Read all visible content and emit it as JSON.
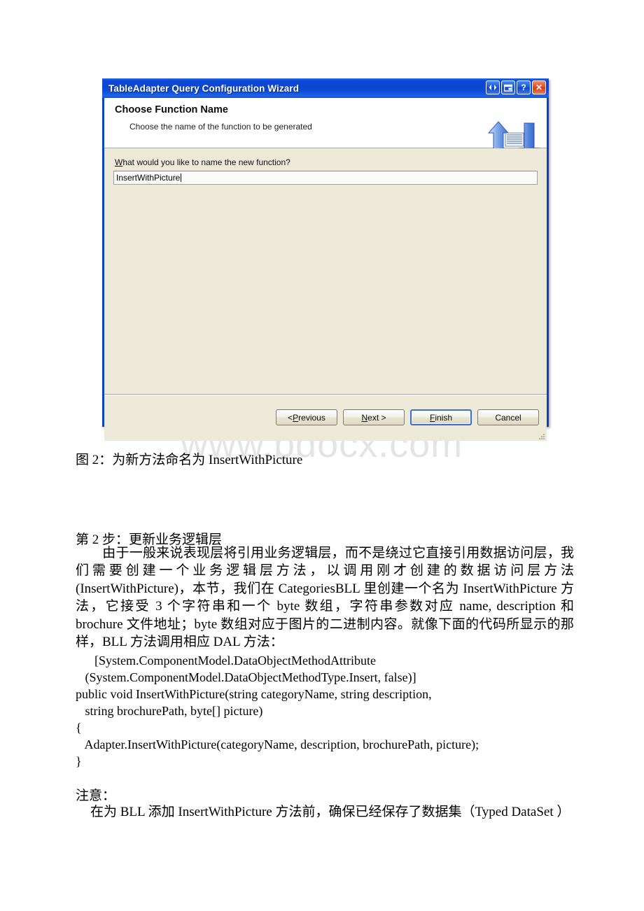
{
  "watermark": "www.bdocx.com",
  "dialog": {
    "title": "TableAdapter Query Configuration Wizard",
    "titlebar_buttons": [
      {
        "name": "resize-icon",
        "glyph": "◀▶"
      },
      {
        "name": "restore-icon",
        "glyph": "❐"
      },
      {
        "name": "help-icon",
        "glyph": "?"
      },
      {
        "name": "close-icon",
        "glyph": "✕"
      }
    ],
    "header": {
      "title": "Choose Function Name",
      "subtitle": "Choose the name of the function to be generated",
      "icon": "data-transfer-arrows-icon"
    },
    "body": {
      "field_label_accesskey": "W",
      "field_label_rest": "hat would you like to name the new function?",
      "input_value": "InsertWithPicture",
      "input_placeholder": ""
    },
    "footer": {
      "buttons": [
        {
          "name": "previous-button",
          "pre": "< ",
          "accesskey": "P",
          "post": "revious",
          "default": false
        },
        {
          "name": "next-button",
          "pre": "",
          "accesskey": "N",
          "post": "ext >",
          "default": false
        },
        {
          "name": "finish-button",
          "pre": "",
          "accesskey": "F",
          "post": "inish",
          "default": true
        },
        {
          "name": "cancel-button",
          "pre": "",
          "accesskey": "",
          "post": "Cancel",
          "default": false
        }
      ]
    },
    "colors": {
      "titlebar_blue": "#0b46d2",
      "body_beige": "#ece9d8",
      "border_blue": "#0a42c8",
      "close_red": "#d33d17",
      "default_button_outline": "#3b6ed0"
    }
  },
  "document": {
    "figure_caption": "图 2：为新方法命名为 InsertWithPicture",
    "section_heading": "第 2 步：更新业务逻辑层",
    "paragraph": "由于一般来说表现层将引用业务逻辑层，而不是绕过它直接引用数据访问层，我们需要创建一个业务逻辑层方法，以调用刚才创建的数据访问层方法(InsertWithPicture)，本节，我们在 CategoriesBLL 里创建一个名为 InsertWithPicture 方法，它接受 3 个字符串和一个 byte 数组，字符串参数对应 name, description 和 brochure 文件地址；byte 数组对应于图片的二进制内容。就像下面的代码所显示的那样，BLL 方法调用相应 DAL 方法：",
    "code": "      [System.ComponentModel.DataObjectMethodAttribute\n   (System.ComponentModel.DataObjectMethodType.Insert, false)]\npublic void InsertWithPicture(string categoryName, string description,\n   string brochurePath, byte[] picture)\n{\n   Adapter.InsertWithPicture(categoryName, description, brochurePath, picture);\n}",
    "note_heading": "注意：",
    "note_body": "在为 BLL 添加 InsertWithPicture 方法前，确保已经保存了数据集（Typed DataSet ）"
  }
}
